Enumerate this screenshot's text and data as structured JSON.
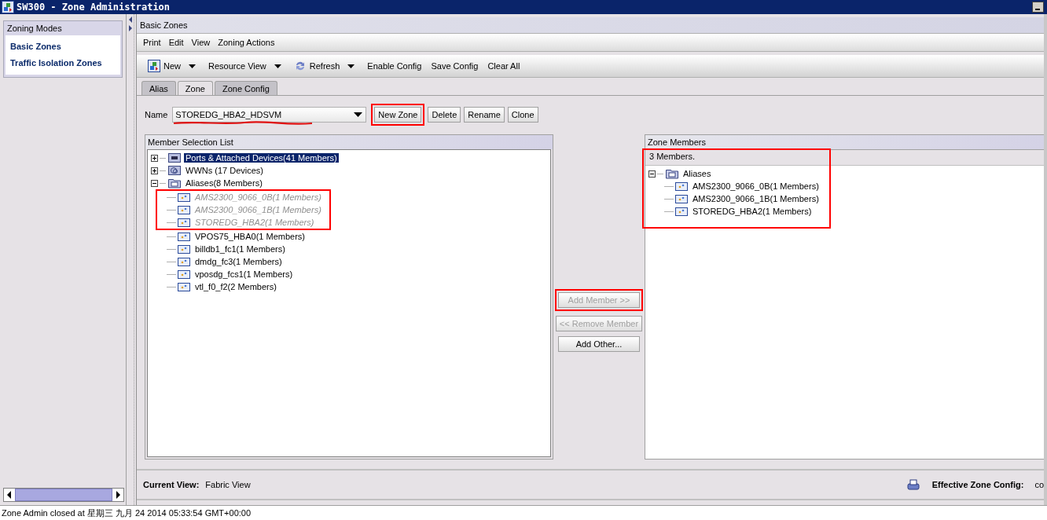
{
  "window": {
    "title": "SW300 - Zone Administration"
  },
  "sidebar": {
    "title": "Zoning Modes",
    "items": [
      {
        "label": "Basic Zones"
      },
      {
        "label": "Traffic Isolation Zones"
      }
    ]
  },
  "panel_title": "Basic Zones",
  "menu": [
    "Print",
    "Edit",
    "View",
    "Zoning Actions"
  ],
  "toolbar": [
    {
      "label": "New",
      "kind": "new",
      "dropdown": true
    },
    {
      "label": "Resource View",
      "kind": "plain",
      "dropdown": true
    },
    {
      "label": "Refresh",
      "kind": "refresh",
      "dropdown": true
    },
    {
      "label": "Enable Config",
      "kind": "plain",
      "dropdown": false
    },
    {
      "label": "Save Config",
      "kind": "plain",
      "dropdown": false
    },
    {
      "label": "Clear All",
      "kind": "plain",
      "dropdown": false
    }
  ],
  "tabs": [
    {
      "label": "Alias",
      "selected": false
    },
    {
      "label": "Zone",
      "selected": true
    },
    {
      "label": "Zone Config",
      "selected": false
    }
  ],
  "zone_name": {
    "label": "Name",
    "value": "STOREDG_HBA2_HDSVM",
    "underlined": true
  },
  "zone_buttons": [
    {
      "label": "New Zone",
      "annotated": true
    },
    {
      "label": "Delete",
      "annotated": false
    },
    {
      "label": "Rename",
      "annotated": false
    },
    {
      "label": "Clone",
      "annotated": false
    }
  ],
  "member_selection": {
    "title": "Member Selection List",
    "tree": [
      {
        "label": "Ports & Attached Devices(41 Members)",
        "kind": "ports",
        "selected": true,
        "expanded": false
      },
      {
        "label": "WWNs (17 Devices)",
        "kind": "wwns",
        "selected": false,
        "expanded": false
      },
      {
        "label": "Aliases(8 Members)",
        "kind": "folder",
        "selected": false,
        "expanded": true,
        "children": [
          {
            "label": "AMS2300_9066_0B(1 Members)",
            "kind": "alias",
            "selected": false,
            "disabled": true,
            "annotated": true
          },
          {
            "label": "AMS2300_9066_1B(1 Members)",
            "kind": "alias",
            "selected": false,
            "disabled": true,
            "annotated": true
          },
          {
            "label": "STOREDG_HBA2(1 Members)",
            "kind": "alias",
            "selected": false,
            "disabled": true,
            "annotated": true
          },
          {
            "label": "VPOS75_HBA0(1 Members)",
            "kind": "alias",
            "selected": false,
            "disabled": false,
            "annotated": false
          },
          {
            "label": "billdb1_fc1(1 Members)",
            "kind": "alias",
            "selected": false,
            "disabled": false,
            "annotated": false
          },
          {
            "label": "dmdg_fc3(1 Members)",
            "kind": "alias",
            "selected": false,
            "disabled": false,
            "annotated": false
          },
          {
            "label": "vposdg_fcs1(1 Members)",
            "kind": "alias",
            "selected": false,
            "disabled": false,
            "annotated": false
          },
          {
            "label": "vtl_f0_f2(2 Members)",
            "kind": "alias",
            "selected": false,
            "disabled": false,
            "annotated": false
          }
        ]
      }
    ]
  },
  "member_buttons": [
    {
      "label": "Add Member >>",
      "disabled": true,
      "annotated": true
    },
    {
      "label": "<< Remove Member",
      "disabled": true,
      "annotated": false
    },
    {
      "label": "Add Other...",
      "disabled": false,
      "annotated": false
    }
  ],
  "zone_members": {
    "title": "Zone Members",
    "count": "3 Members.",
    "annotated": true,
    "tree": [
      {
        "label": "Aliases",
        "kind": "folder",
        "selected": false,
        "expanded": true,
        "children": [
          {
            "label": "AMS2300_9066_0B(1 Members)",
            "kind": "alias",
            "selected": false,
            "disabled": false,
            "annotated": false
          },
          {
            "label": "AMS2300_9066_1B(1 Members)",
            "kind": "alias",
            "selected": false,
            "disabled": false,
            "annotated": false
          },
          {
            "label": "STOREDG_HBA2(1 Members)",
            "kind": "alias",
            "selected": false,
            "disabled": false,
            "annotated": false
          }
        ]
      }
    ]
  },
  "footer": {
    "view_label": "Current View:",
    "view_value": "Fabric View",
    "config_label": "Effective Zone Config:",
    "config_value": "co"
  },
  "status_bar": "Zone Admin closed at 星期三 九月 24 2014 05:33:54 GMT+00:00"
}
